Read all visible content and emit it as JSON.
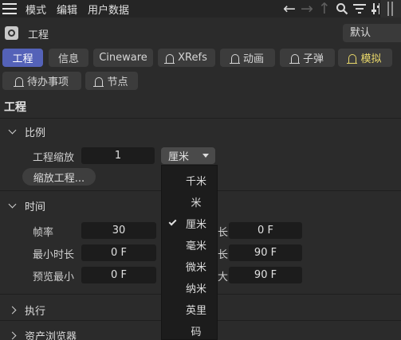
{
  "menubar": {
    "items": [
      "模式",
      "编辑",
      "用户数据"
    ],
    "icons": [
      "hamburger-icon",
      "arrow-left-icon",
      "arrow-right-icon",
      "arrow-up-icon",
      "search-icon",
      "filter-icon",
      "sliders-icon"
    ]
  },
  "titlebar": {
    "title": "工程",
    "preset": "默认"
  },
  "tabs": [
    {
      "label": "工程",
      "active": true
    },
    {
      "label": "信息"
    },
    {
      "label": "Cineware"
    },
    {
      "label": "XRefs",
      "bell": true
    },
    {
      "label": "动画",
      "bell": true
    },
    {
      "label": "子弹",
      "bell": true
    },
    {
      "label": "模拟",
      "bell": true,
      "color": "#e8d76a"
    },
    {
      "label": "待办事项",
      "bell": true
    },
    {
      "label": "节点",
      "bell": true
    }
  ],
  "section_title": "工程",
  "scale_group": {
    "title": "比例",
    "scale_label": "工程缩放",
    "scale_value": "1",
    "unit_value": "厘米",
    "scale_button": "缩放工程..."
  },
  "time_group": {
    "title": "时间",
    "fps_label": "帧率",
    "fps_value": "30",
    "min_label": "最小时长",
    "min_value": "0 F",
    "preview_min_label": "预览最小",
    "preview_min_value": "0 F",
    "right_label_1": "长",
    "right_value_1": "0 F",
    "right_label_2": "长",
    "right_value_2": "90 F",
    "right_label_3": "大",
    "right_value_3": "90 F"
  },
  "collapsed_groups": [
    "执行",
    "资产浏览器"
  ],
  "unit_dropdown": {
    "options": [
      "千米",
      "米",
      "厘米",
      "毫米",
      "微米",
      "纳米",
      "英里",
      "码"
    ],
    "selected": "厘米"
  }
}
